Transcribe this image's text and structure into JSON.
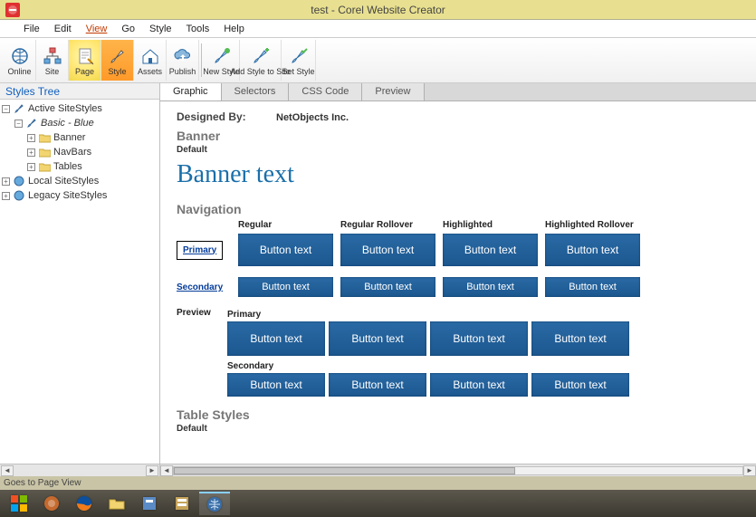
{
  "titlebar": {
    "title": "test - Corel Website Creator"
  },
  "menubar": {
    "items": [
      "File",
      "Edit",
      "View",
      "Go",
      "Style",
      "Tools",
      "Help"
    ],
    "highlighted_index": 2
  },
  "toolbar": {
    "groups": [
      [
        "Online",
        "Site",
        "Page",
        "Style",
        "Assets",
        "Publish"
      ],
      [
        "New Style",
        "Add Style to Site",
        "Set Style"
      ]
    ],
    "selected": "Page"
  },
  "sidebar": {
    "title": "Styles Tree",
    "tree": {
      "root": "Active SiteStyles",
      "basic": "Basic - Blue",
      "children": [
        "Banner",
        "NavBars",
        "Tables"
      ],
      "siblings": [
        "Local SiteStyles",
        "Legacy SiteStyles"
      ]
    }
  },
  "tabs": {
    "items": [
      "Graphic",
      "Selectors",
      "CSS Code",
      "Preview"
    ],
    "active_index": 0
  },
  "content": {
    "designed_by_label": "Designed By:",
    "designed_by_value": "NetObjects Inc.",
    "banner_head": "Banner",
    "banner_sub": "Default",
    "banner_text": "Banner text",
    "nav_head": "Navigation",
    "nav_cols": [
      "Regular",
      "Regular Rollover",
      "Highlighted",
      "Highlighted Rollover"
    ],
    "nav_rows": [
      {
        "label": "Primary",
        "kind": "big",
        "cells": [
          "Button text",
          "Button text",
          "Button text",
          "Button text"
        ]
      },
      {
        "label": "Secondary",
        "kind": "sm",
        "cells": [
          "Button text",
          "Button text",
          "Button text",
          "Button text"
        ]
      }
    ],
    "preview_label": "Preview",
    "preview_primary_label": "Primary",
    "preview_secondary_label": "Secondary",
    "preview_primary": [
      "Button text",
      "Button text",
      "Button text",
      "Button text"
    ],
    "preview_secondary": [
      "Button text",
      "Button text",
      "Button text",
      "Button text"
    ],
    "table_styles_head": "Table Styles",
    "table_styles_sub": "Default"
  },
  "statusbar": {
    "text": "Goes to Page View"
  },
  "colors": {
    "accent": "#1c578f",
    "titlebar": "#e8e090"
  }
}
